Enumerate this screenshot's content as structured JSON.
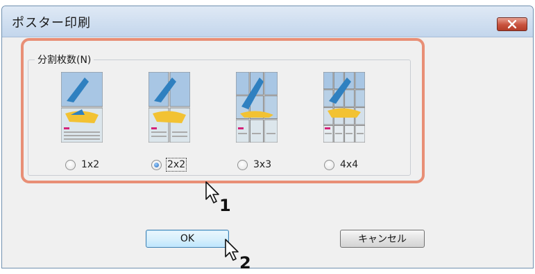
{
  "window": {
    "title": "ポスター印刷"
  },
  "group": {
    "label": "分割枚数(N)",
    "options": [
      {
        "label": "1x2",
        "selected": false
      },
      {
        "label": "2x2",
        "selected": true
      },
      {
        "label": "3x3",
        "selected": false
      },
      {
        "label": "4x4",
        "selected": false
      }
    ]
  },
  "buttons": {
    "ok": "OK",
    "cancel": "キャンセル"
  },
  "annotations": {
    "step1": "1",
    "step2": "2"
  },
  "colors": {
    "highlight": "#e88f76",
    "titlebar": "#c3d6ec",
    "close_button": "#c8523d"
  },
  "icons": [
    "close-icon",
    "mouse-cursor-icon"
  ]
}
